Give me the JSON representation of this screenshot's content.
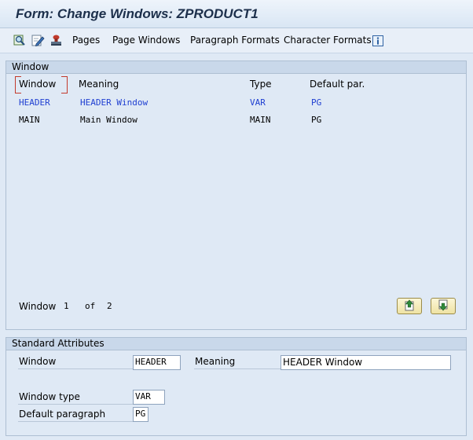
{
  "window_title": "Form: Change Windows: ZPRODUCT1",
  "toolbar": {
    "icons": [
      "find-icon",
      "edit-pencil-icon",
      "stamp-icon"
    ],
    "buttons": [
      "Pages",
      "Page Windows",
      "Paragraph Formats",
      "Character Formats"
    ],
    "info_icon": "info-icon"
  },
  "window_panel": {
    "title": "Window",
    "columns": [
      "Window",
      "Meaning",
      "Type",
      "Default par."
    ],
    "rows": [
      {
        "window": "HEADER",
        "meaning": "HEADER Window",
        "type": "VAR",
        "default_par": "PG",
        "selected": true
      },
      {
        "window": "MAIN",
        "meaning": "Main Window",
        "type": "MAIN",
        "default_par": "PG",
        "selected": false
      }
    ],
    "pager": {
      "label": "Window",
      "current": "1",
      "of": "of",
      "total": "2"
    },
    "nav_icons": [
      "scroll-up-icon",
      "scroll-down-icon"
    ]
  },
  "attributes_panel": {
    "title": "Standard Attributes",
    "window_label": "Window",
    "window_value": "HEADER",
    "meaning_label": "Meaning",
    "meaning_value": "HEADER Window",
    "window_type_label": "Window type",
    "window_type_value": "VAR",
    "default_paragraph_label": "Default paragraph",
    "default_paragraph_value": "PG"
  },
  "colors": {
    "background": "#dfe9f5",
    "panel_header": "#c9d8ea",
    "selected_text": "#1f3fd1",
    "title_text": "#1c2f4b",
    "nav_button": "#f3e9b5"
  }
}
